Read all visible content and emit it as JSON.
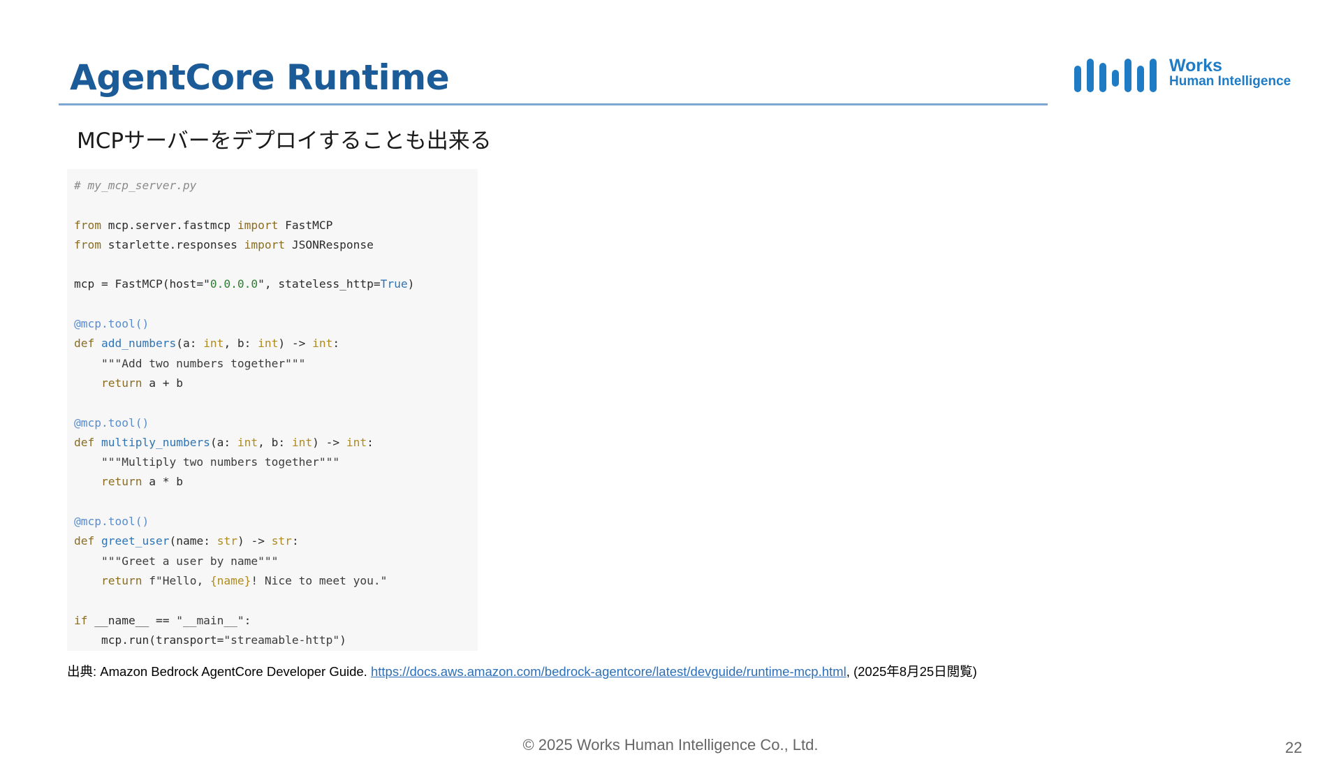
{
  "slide": {
    "title": "AgentCore Runtime",
    "subtitle": "MCPサーバーをデプロイすることも出来る",
    "logo": {
      "name": "Works",
      "sub": "Human Intelligence"
    },
    "code_lines": [
      "# my_mcp_server.py",
      "",
      "from mcp.server.fastmcp import FastMCP",
      "from starlette.responses import JSONResponse",
      "",
      "mcp = FastMCP(host=\"0.0.0.0\", stateless_http=True)",
      "",
      "@mcp.tool()",
      "def add_numbers(a: int, b: int) -> int:",
      "    \"\"\"Add two numbers together\"\"\"",
      "    return a + b",
      "",
      "@mcp.tool()",
      "def multiply_numbers(a: int, b: int) -> int:",
      "    \"\"\"Multiply two numbers together\"\"\"",
      "    return a * b",
      "",
      "@mcp.tool()",
      "def greet_user(name: str) -> str:",
      "    \"\"\"Greet a user by name\"\"\"",
      "    return f\"Hello, {name}! Nice to meet you.\"",
      "",
      "if __name__ == \"__main__\":",
      "    mcp.run(transport=\"streamable-http\")"
    ],
    "source": {
      "prefix": "出典: Amazon Bedrock AgentCore Developer Guide. ",
      "url": "https://docs.aws.amazon.com/bedrock-agentcore/latest/devguide/runtime-mcp.html",
      "suffix": ", (2025年8月25日閲覧)"
    },
    "footer": "© 2025 Works Human Intelligence Co., Ltd.",
    "page_number": "22"
  },
  "colors": {
    "title": "#1b5b97",
    "rule": "#7ba7d0",
    "logo": "#1f7bc4",
    "link": "#2c6fb7"
  }
}
